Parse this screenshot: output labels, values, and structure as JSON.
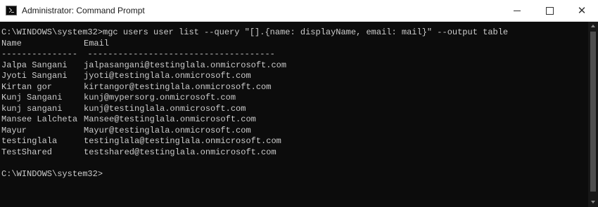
{
  "window": {
    "title": "Administrator: Command Prompt",
    "icon": "cmd-icon",
    "controls": {
      "minimize": "minimize-icon",
      "maximize": "maximize-icon",
      "close": "close-icon"
    }
  },
  "console": {
    "command_line": "C:\\WINDOWS\\system32>mgc users user list --query \"[].{name: displayName, email: mail}\" --output table",
    "header": {
      "name": "Name",
      "email": "Email"
    },
    "separator": "---------------  -------------------------------------",
    "rows": [
      {
        "name": "Jalpa Sangani",
        "email": "jalpasangani@testinglala.onmicrosoft.com"
      },
      {
        "name": "Jyoti Sangani",
        "email": "jyoti@testinglala.onmicrosoft.com"
      },
      {
        "name": "Kirtan gor",
        "email": "kirtangor@testinglala.onmicrosoft.com"
      },
      {
        "name": "Kunj Sangani",
        "email": "kunj@mypersorg.onmicrosoft.com"
      },
      {
        "name": "kunj sangani",
        "email": "kunj@testinglala.onmicrosoft.com"
      },
      {
        "name": "Mansee Lalcheta",
        "email": "Mansee@testinglala.onmicrosoft.com"
      },
      {
        "name": "Mayur",
        "email": "Mayur@testinglala.onmicrosoft.com"
      },
      {
        "name": "testinglala",
        "email": "testinglala@testinglala.onmicrosoft.com"
      },
      {
        "name": "TestShared",
        "email": "testshared@testinglala.onmicrosoft.com"
      }
    ],
    "prompt": "C:\\WINDOWS\\system32>"
  },
  "colors": {
    "console_background": "#0c0c0c",
    "console_text": "#cccccc",
    "titlebar_background": "#ffffff"
  }
}
